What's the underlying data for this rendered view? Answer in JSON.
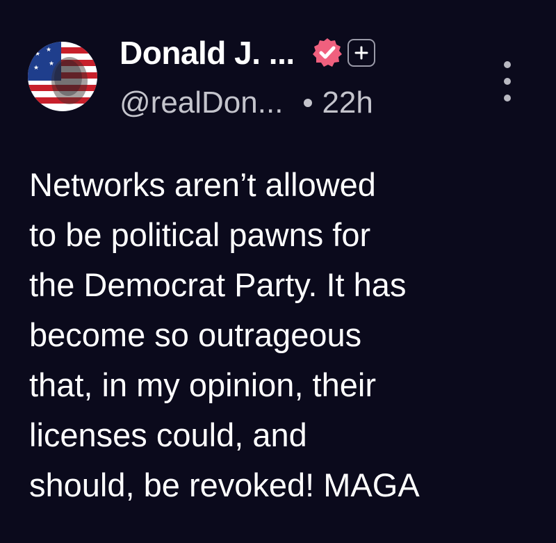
{
  "author": {
    "display_name": "Donald J. ...",
    "handle": "@realDon...",
    "verified": true
  },
  "post": {
    "time_ago": "22h",
    "body_lines": [
      "Networks aren’t allowed",
      "to be political pawns for",
      "the Democrat Party. It has",
      "become so outrageous",
      "that, in my opinion, their",
      "licenses could, and",
      "should, be revoked! MAGA"
    ]
  },
  "icons": {
    "verified": "verified-badge-icon",
    "follow": "plus-icon",
    "more": "more-vertical-icon"
  },
  "colors": {
    "background": "#0b0a1c",
    "verified_badge": "#f0607e",
    "text_primary": "#ffffff",
    "text_secondary": "#c4c4cc"
  }
}
